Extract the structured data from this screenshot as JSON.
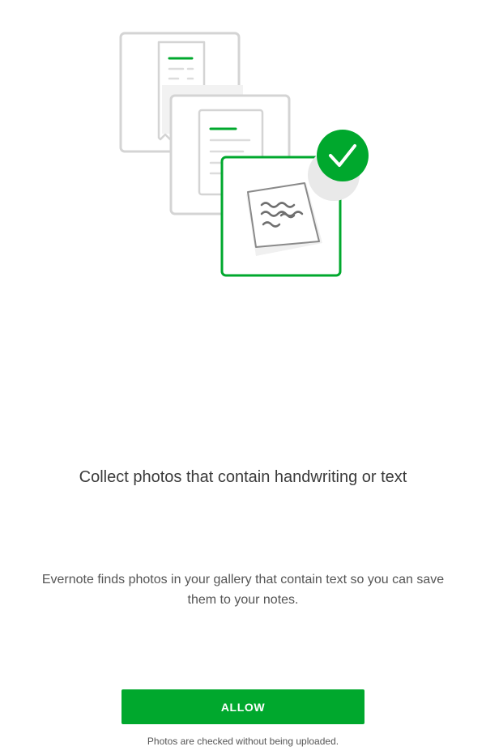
{
  "colors": {
    "accent": "#00a82d",
    "illustration_gray": "#cfcfcf",
    "text_primary": "#3b3b3b",
    "text_secondary": "#555555"
  },
  "illustration": {
    "icons": [
      "receipt-card-icon",
      "document-card-icon",
      "handwritten-note-card-icon",
      "checkmark-badge-icon"
    ]
  },
  "onboarding": {
    "title": "Collect photos that contain handwriting or text",
    "description": "Evernote finds photos in your gallery that contain text so you can save them to your notes.",
    "allow_label": "ALLOW",
    "footnote": "Photos are checked without being uploaded."
  }
}
